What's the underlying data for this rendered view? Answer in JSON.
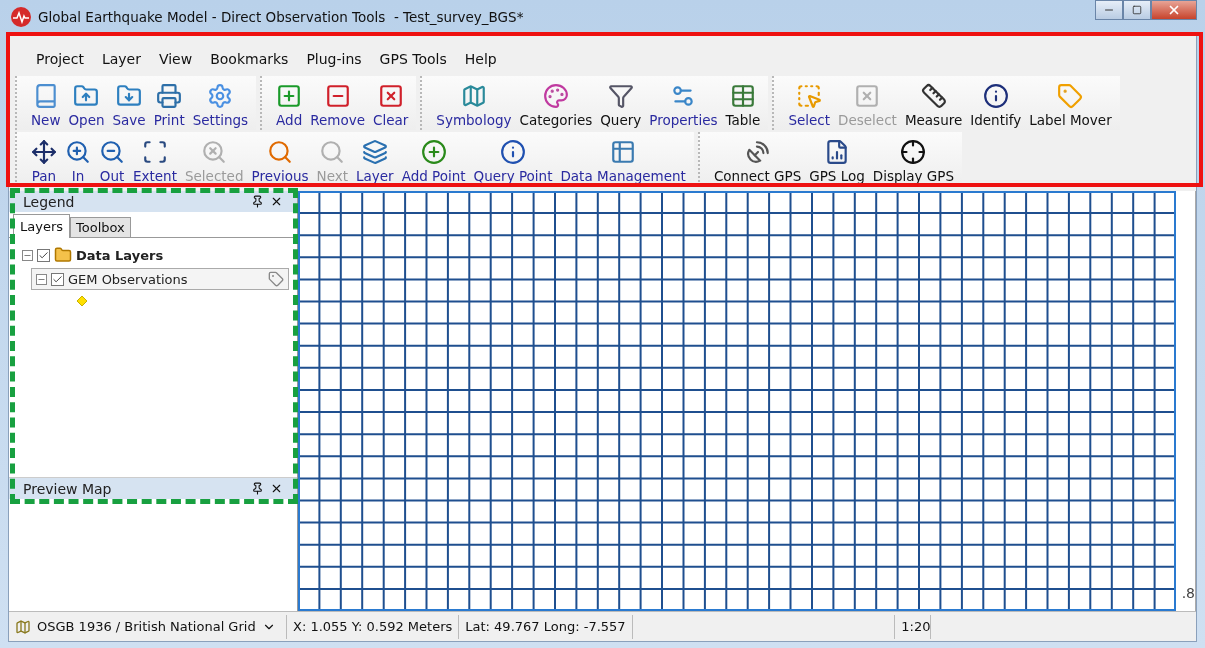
{
  "window": {
    "title": "Global Earthquake Model - Direct Observation Tools  - Test_survey_BGS*"
  },
  "menu": [
    "Project",
    "Layer",
    "View",
    "Bookmarks",
    "Plug-ins",
    "GPS Tools",
    "Help"
  ],
  "toolbars": [
    [
      [
        {
          "label": "New",
          "kind": "accent",
          "disabled": false
        },
        {
          "label": "Open",
          "kind": "accent",
          "disabled": false
        },
        {
          "label": "Save",
          "kind": "accent",
          "disabled": false
        },
        {
          "label": "Print",
          "kind": "accent",
          "disabled": false
        },
        {
          "label": "Settings",
          "kind": "accent",
          "disabled": false
        }
      ],
      [
        {
          "label": "Add",
          "kind": "accent",
          "disabled": false
        },
        {
          "label": "Remove",
          "kind": "accent",
          "disabled": false
        },
        {
          "label": "Clear",
          "kind": "accent",
          "disabled": false
        }
      ],
      [
        {
          "label": "Symbology",
          "kind": "accent",
          "disabled": false
        },
        {
          "label": "Categories",
          "kind": "plain",
          "disabled": false
        },
        {
          "label": "Query",
          "kind": "plain",
          "disabled": false
        },
        {
          "label": "Properties",
          "kind": "accent",
          "disabled": false
        },
        {
          "label": "Table",
          "kind": "plain",
          "disabled": false
        }
      ],
      [
        {
          "label": "Select",
          "kind": "accent",
          "disabled": false
        },
        {
          "label": "Deselect",
          "disabled": true
        },
        {
          "label": "Measure",
          "kind": "plain",
          "disabled": false
        },
        {
          "label": "Identify",
          "kind": "plain",
          "disabled": false
        },
        {
          "label": "Label Mover",
          "kind": "plain",
          "disabled": false
        }
      ]
    ],
    [
      [
        {
          "label": "Pan",
          "kind": "accent",
          "disabled": false
        },
        {
          "label": "In",
          "kind": "accent",
          "disabled": false
        },
        {
          "label": "Out",
          "kind": "accent",
          "disabled": false
        },
        {
          "label": "Extent",
          "kind": "accent",
          "disabled": false
        },
        {
          "label": "Selected",
          "disabled": true
        },
        {
          "label": "Previous",
          "kind": "accent",
          "disabled": false
        },
        {
          "label": "Next",
          "disabled": true
        },
        {
          "label": "Layer",
          "kind": "accent",
          "disabled": false
        },
        {
          "label": "Add Point",
          "kind": "accent",
          "disabled": false
        },
        {
          "label": "Query Point",
          "kind": "accent",
          "disabled": false
        },
        {
          "label": "Data Management",
          "kind": "accent",
          "disabled": false
        }
      ],
      [
        {
          "label": "Connect GPS",
          "kind": "plain",
          "disabled": false
        },
        {
          "label": "GPS Log",
          "kind": "plain",
          "disabled": false
        },
        {
          "label": "Display GPS",
          "kind": "plain",
          "disabled": false
        }
      ]
    ]
  ],
  "legend": {
    "title": "Legend",
    "tabs": [
      {
        "label": "Layers",
        "selected": true
      },
      {
        "label": "Toolbox",
        "selected": false
      }
    ],
    "tree": [
      {
        "label": "Data Layers",
        "expanded": true,
        "checked": true,
        "selected": false,
        "children": [
          {
            "label": "GEM Observations",
            "expanded": true,
            "checked": true,
            "selected": true
          }
        ]
      }
    ]
  },
  "preview": {
    "title": "Preview Map"
  },
  "map": {
    "scale_label": ".8"
  },
  "status_bar": {
    "projection": "OSGB 1936 / British National Grid",
    "coordinates": "X: 1.055 Y: 0.592 Meters",
    "latlong": "Lat: 49.767 Long: -7.557",
    "scale": "1:20"
  }
}
